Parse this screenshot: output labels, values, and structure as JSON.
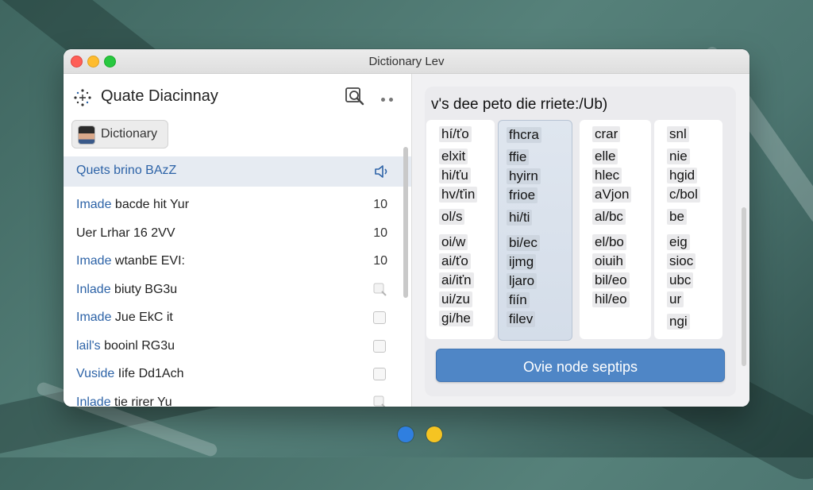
{
  "window": {
    "title": "Dictionary Lev"
  },
  "sidebar": {
    "app_title": "Quate Diacinnay",
    "search_icon": "magnifier-icon",
    "more_icon": "ellipsis-icon",
    "chip_label": "Dictionary",
    "items": [
      {
        "lead": "Quets",
        "rest": " brino BAzZ",
        "trail": "speaker"
      },
      {
        "lead": "Imade",
        "rest": " bacde hit Yur",
        "count": "10"
      },
      {
        "lead": "",
        "rest": "Uer Lrhar 16 2VV",
        "count": "10"
      },
      {
        "lead": "Imade",
        "rest": " wtanbE EVI:",
        "count": "10"
      },
      {
        "lead": "Inlade",
        "rest": " biuty BG3u",
        "trail": "magnifier"
      },
      {
        "lead": "Imade",
        "rest": " Jue EkC it",
        "trail": "checkbox"
      },
      {
        "lead": "lail's",
        "rest": " booinl RG3u",
        "trail": "checkbox"
      },
      {
        "lead": "Vuside",
        "rest": " Iife Dd1Ach",
        "trail": "checkbox"
      },
      {
        "lead": "Inlade",
        "rest": " tie rirer Yu",
        "trail": "magnifier"
      }
    ]
  },
  "main": {
    "heading": "v's dee peto die rriete:/Ub)",
    "columns": [
      [
        "hí/ťo",
        "elxit",
        "hi/ťu",
        "hv/ťin",
        "ol/s",
        "oi/w",
        "ai/ťo",
        "ai/iťn",
        "ui/zu",
        "gi/he"
      ],
      [
        "fhcra",
        "ffie",
        "hyirn",
        "frioe",
        "hi/ti",
        "bi/ec",
        "ijmg",
        "ljaro",
        "fiín",
        "filev"
      ],
      [
        "crar",
        "elle",
        "hlec",
        "aVjon",
        "al/bc",
        "el/bo",
        "oiuih",
        "bil/eo",
        "hil/eo"
      ],
      [
        "snl",
        "nie",
        "hgid",
        "c/bol",
        "be",
        "eig",
        "sioc",
        "ubc",
        "ur",
        "ngi"
      ]
    ],
    "action_label": "Ovie node septips"
  },
  "colors": {
    "accent": "#4f86c6",
    "link_blue": "#2d63a7",
    "selection": "#e6ebf2"
  },
  "dock": [
    "browser-icon",
    "notes-icon"
  ]
}
